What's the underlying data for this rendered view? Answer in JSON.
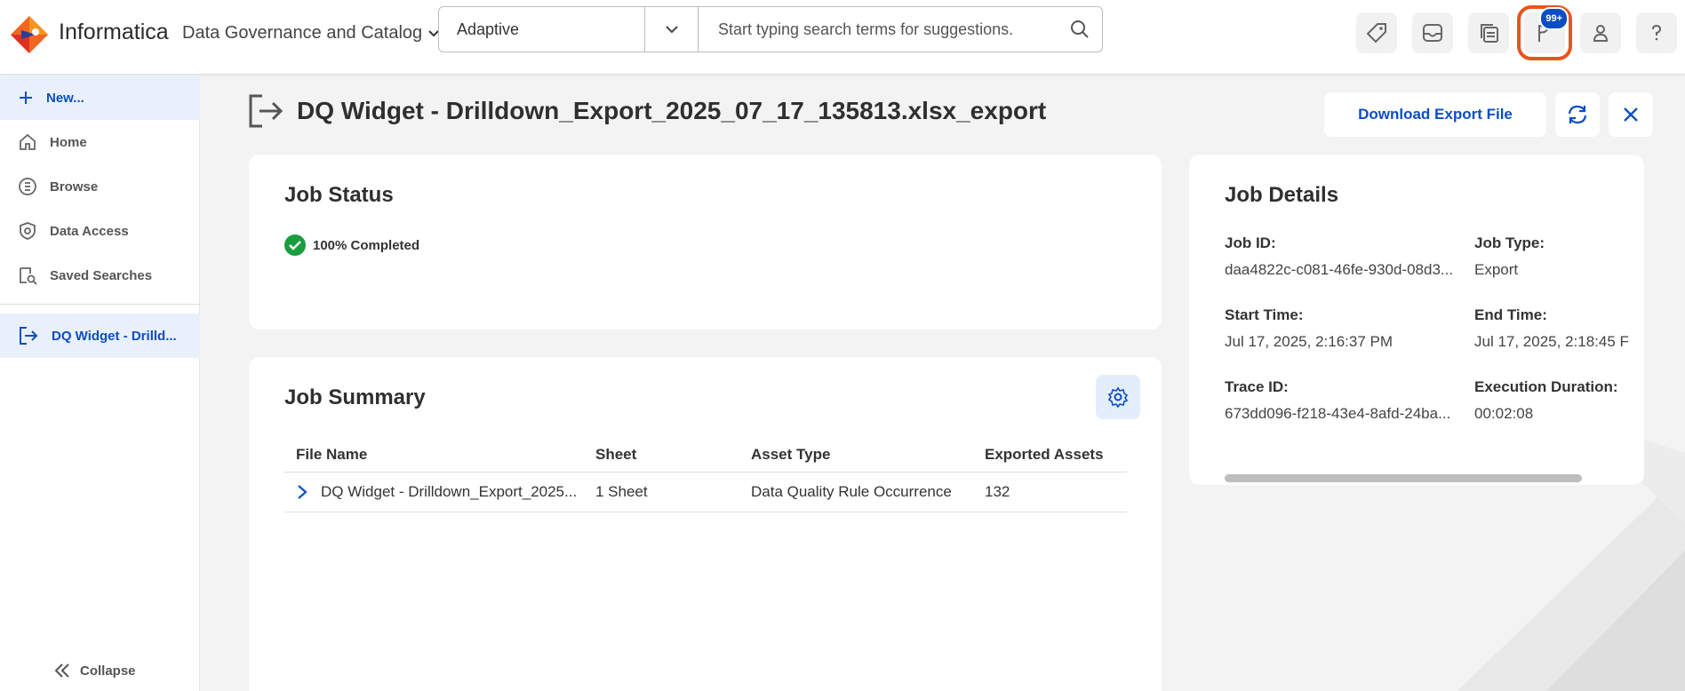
{
  "header": {
    "brand": "Informatica",
    "product": "Data Governance and Catalog",
    "search": {
      "scope": "Adaptive",
      "placeholder": "Start typing search terms for suggestions."
    },
    "notification_badge": "99+"
  },
  "sidebar": {
    "new_label": "New...",
    "items": [
      {
        "label": "Home"
      },
      {
        "label": "Browse"
      },
      {
        "label": "Data Access"
      },
      {
        "label": "Saved Searches"
      }
    ],
    "active_tab": "DQ Widget - Drilld...",
    "collapse_label": "Collapse"
  },
  "page": {
    "title": "DQ Widget - Drilldown_Export_2025_07_17_135813.xlsx_export",
    "download_label": "Download Export File"
  },
  "job_status": {
    "title": "Job Status",
    "status_text": "100% Completed"
  },
  "job_summary": {
    "title": "Job Summary",
    "columns": [
      "File Name",
      "Sheet",
      "Asset Type",
      "Exported Assets"
    ],
    "rows": [
      {
        "file_name": "DQ Widget - Drilldown_Export_2025...",
        "sheet": "1 Sheet",
        "asset_type": "Data Quality Rule Occurrence",
        "exported_assets": "132"
      }
    ]
  },
  "job_details": {
    "title": "Job Details",
    "job_id_label": "Job ID:",
    "job_id": "daa4822c-c081-46fe-930d-08d3...",
    "job_type_label": "Job Type:",
    "job_type": "Export",
    "start_time_label": "Start Time:",
    "start_time": "Jul 17, 2025, 2:16:37 PM",
    "end_time_label": "End Time:",
    "end_time": "Jul 17, 2025, 2:18:45 F",
    "trace_id_label": "Trace ID:",
    "trace_id": "673dd096-f218-43e4-8afd-24ba...",
    "duration_label": "Execution Duration:",
    "duration": "00:02:08"
  },
  "colors": {
    "accent": "#0b4ec2",
    "success": "#1a9d3f",
    "highlight": "#e8541e"
  }
}
